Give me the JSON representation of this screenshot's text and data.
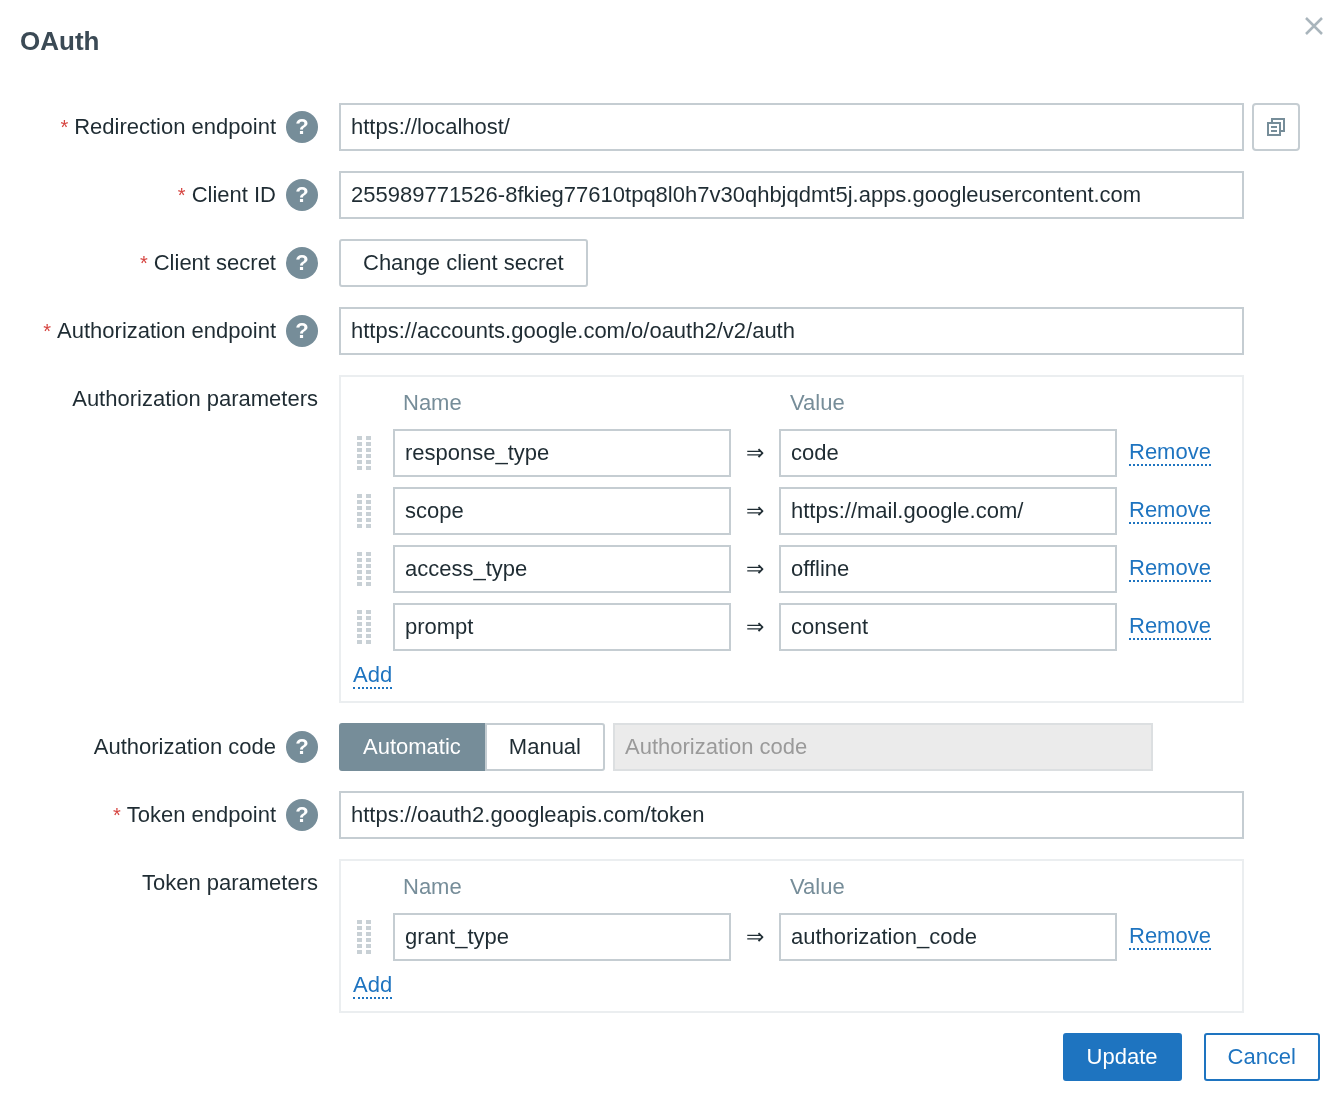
{
  "dialog": {
    "title": "OAuth"
  },
  "fields": [
    {
      "kind": "text",
      "label": "Redirection endpoint",
      "marker": "*",
      "help": "?",
      "value": "https://localhost/",
      "copy": true
    },
    {
      "kind": "text",
      "label": "Client ID",
      "marker": "*",
      "help": "?",
      "value": "255989771526-8fkieg77610tpq8l0h7v30qhbjqdmt5j.apps.googleusercontent.com"
    },
    {
      "kind": "button",
      "label": "Client secret",
      "marker": "*",
      "help": "?",
      "button": "Change client secret"
    },
    {
      "kind": "text",
      "label": "Authorization endpoint",
      "marker": "*",
      "help": "?",
      "value": "https://accounts.google.com/o/oauth2/v2/auth"
    },
    {
      "kind": "params",
      "label": "Authorization parameters",
      "name_header": "Name",
      "value_header": "Value",
      "add": "Add",
      "rows": [
        {
          "name": "response_type",
          "arrow": "⇒",
          "value": "code",
          "remove": "Remove"
        },
        {
          "name": "scope",
          "arrow": "⇒",
          "value": "https://mail.google.com/",
          "remove": "Remove"
        },
        {
          "name": "access_type",
          "arrow": "⇒",
          "value": "offline",
          "remove": "Remove"
        },
        {
          "name": "prompt",
          "arrow": "⇒",
          "value": "consent",
          "remove": "Remove"
        }
      ]
    },
    {
      "kind": "mode",
      "label": "Authorization code",
      "help": "?",
      "options": [
        {
          "label": "Automatic",
          "selected": true
        },
        {
          "label": "Manual",
          "selected": false
        }
      ],
      "code": {
        "placeholder": "Authorization code",
        "disabled": true
      }
    },
    {
      "kind": "text",
      "label": "Token endpoint",
      "marker": "*",
      "help": "?",
      "value": "https://oauth2.googleapis.com/token"
    },
    {
      "kind": "params",
      "label": "Token parameters",
      "name_header": "Name",
      "value_header": "Value",
      "add": "Add",
      "rows": [
        {
          "name": "grant_type",
          "arrow": "⇒",
          "value": "authorization_code",
          "remove": "Remove"
        }
      ]
    }
  ],
  "buttons": [
    {
      "label": "Update",
      "primary": true
    },
    {
      "label": "Cancel",
      "primary": false
    }
  ]
}
